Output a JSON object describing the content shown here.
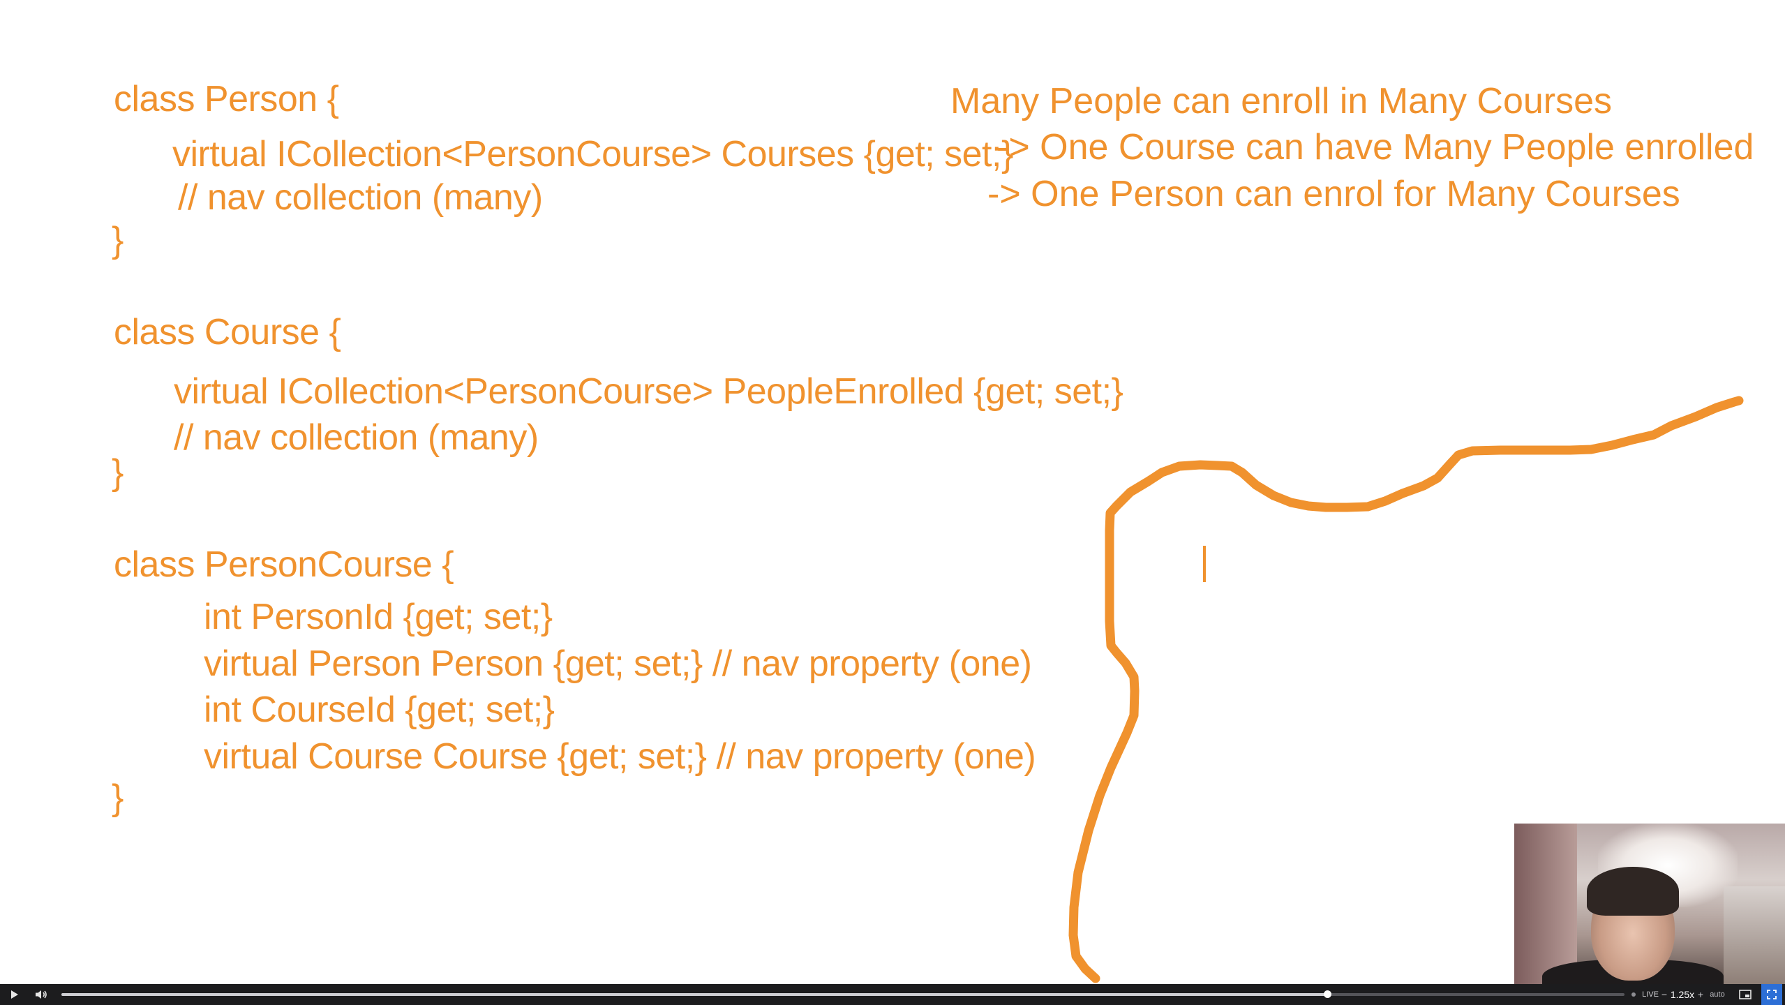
{
  "slide": {
    "ink_color": "#F0922E",
    "code_lines": [
      "class Person {",
      "virtual ICollection<PersonCourse> Courses {get; set;}",
      "// nav collection (many)",
      "}",
      "class Course {",
      "virtual ICollection<PersonCourse> PeopleEnrolled {get; set;}",
      "// nav collection (many)",
      "}",
      "class PersonCourse {",
      "int PersonId {get; set;}",
      "virtual Person Person {get; set;} // nav property (one)",
      "int CourseId {get; set;}",
      "virtual Course Course {get; set;} // nav property (one)",
      "}"
    ],
    "notes": [
      "Many People can enroll in Many Courses",
      "-> One Course can have Many People enrolled",
      "-> One Person can enrol for Many Courses"
    ]
  },
  "player": {
    "play_icon": "play-icon",
    "volume_icon": "volume-icon",
    "progress": 0.81,
    "live_label": "LIVE",
    "speed_minus": "−",
    "speed": "1.25x",
    "speed_plus": "+",
    "quality": "auto",
    "pip_icon": "picture-in-picture-icon",
    "fullscreen_icon": "fullscreen-icon",
    "accent": "#2D6FD6"
  }
}
